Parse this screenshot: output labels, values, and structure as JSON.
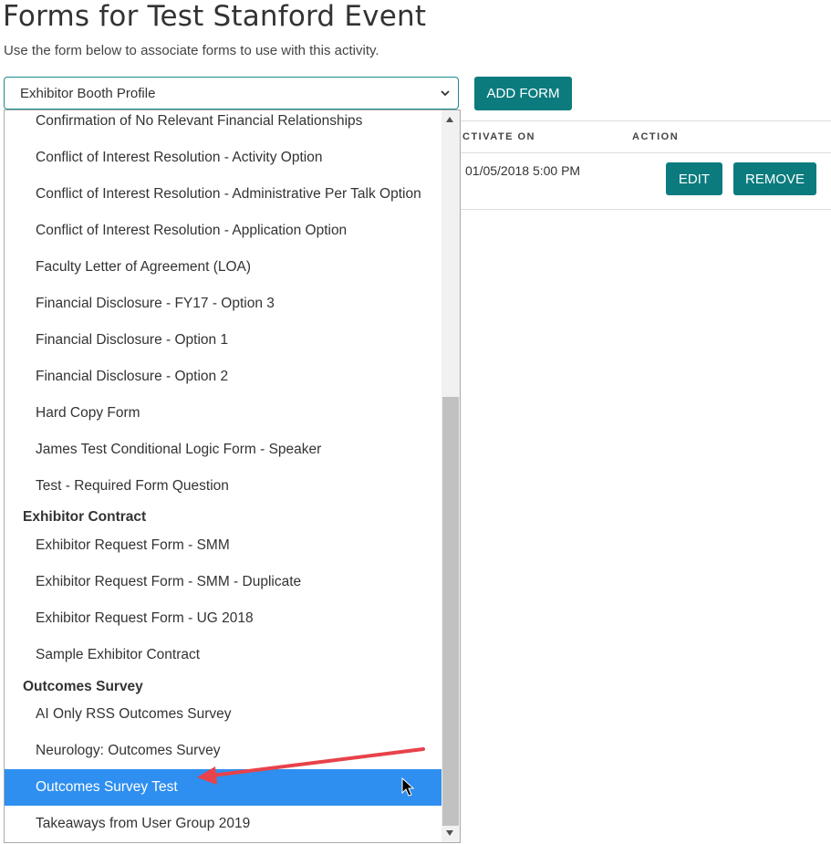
{
  "page": {
    "title": "Forms for Test Stanford Event",
    "subtitle": "Use the form below to associate forms to use with this activity."
  },
  "form_select": {
    "selected_value": "Exhibitor Booth Profile",
    "add_button_label": "ADD FORM"
  },
  "table": {
    "headers": {
      "activate_on": "CTIVATE ON",
      "action": "ACTION"
    },
    "rows": [
      {
        "activate_on": "01/05/2018 5:00 PM",
        "edit_label": "EDIT",
        "remove_label": "REMOVE"
      }
    ]
  },
  "dropdown": {
    "options": [
      "Confirmation of No Relevant Financial Relationships",
      "Conflict of Interest Resolution - Activity Option",
      "Conflict of Interest Resolution - Administrative Per Talk Option",
      "Conflict of Interest Resolution - Application Option",
      "Faculty Letter of Agreement (LOA)",
      "Financial Disclosure - FY17 - Option 3",
      "Financial Disclosure - Option 1",
      "Financial Disclosure - Option 2",
      "Hard Copy Form",
      "James Test Conditional Logic Form - Speaker",
      "Test - Required Form Question"
    ],
    "group_exhibitor_contract": {
      "label": "Exhibitor Contract",
      "options": [
        "Exhibitor Request Form - SMM",
        "Exhibitor Request Form - SMM - Duplicate",
        "Exhibitor Request Form - UG 2018",
        "Sample Exhibitor Contract"
      ]
    },
    "group_outcomes_survey": {
      "label": "Outcomes Survey",
      "options": [
        "AI Only RSS Outcomes Survey",
        "Neurology: Outcomes Survey",
        "Outcomes Survey Test",
        "Takeaways from User Group 2019"
      ],
      "highlighted": "Outcomes Survey Test"
    }
  },
  "colors": {
    "teal": "#0b7b7e",
    "highlight": "#2e8ff0",
    "arrow": "#e8424a"
  },
  "icons": [
    "chevron-down-icon",
    "scroll-up-icon",
    "scroll-down-icon",
    "cursor-icon"
  ]
}
